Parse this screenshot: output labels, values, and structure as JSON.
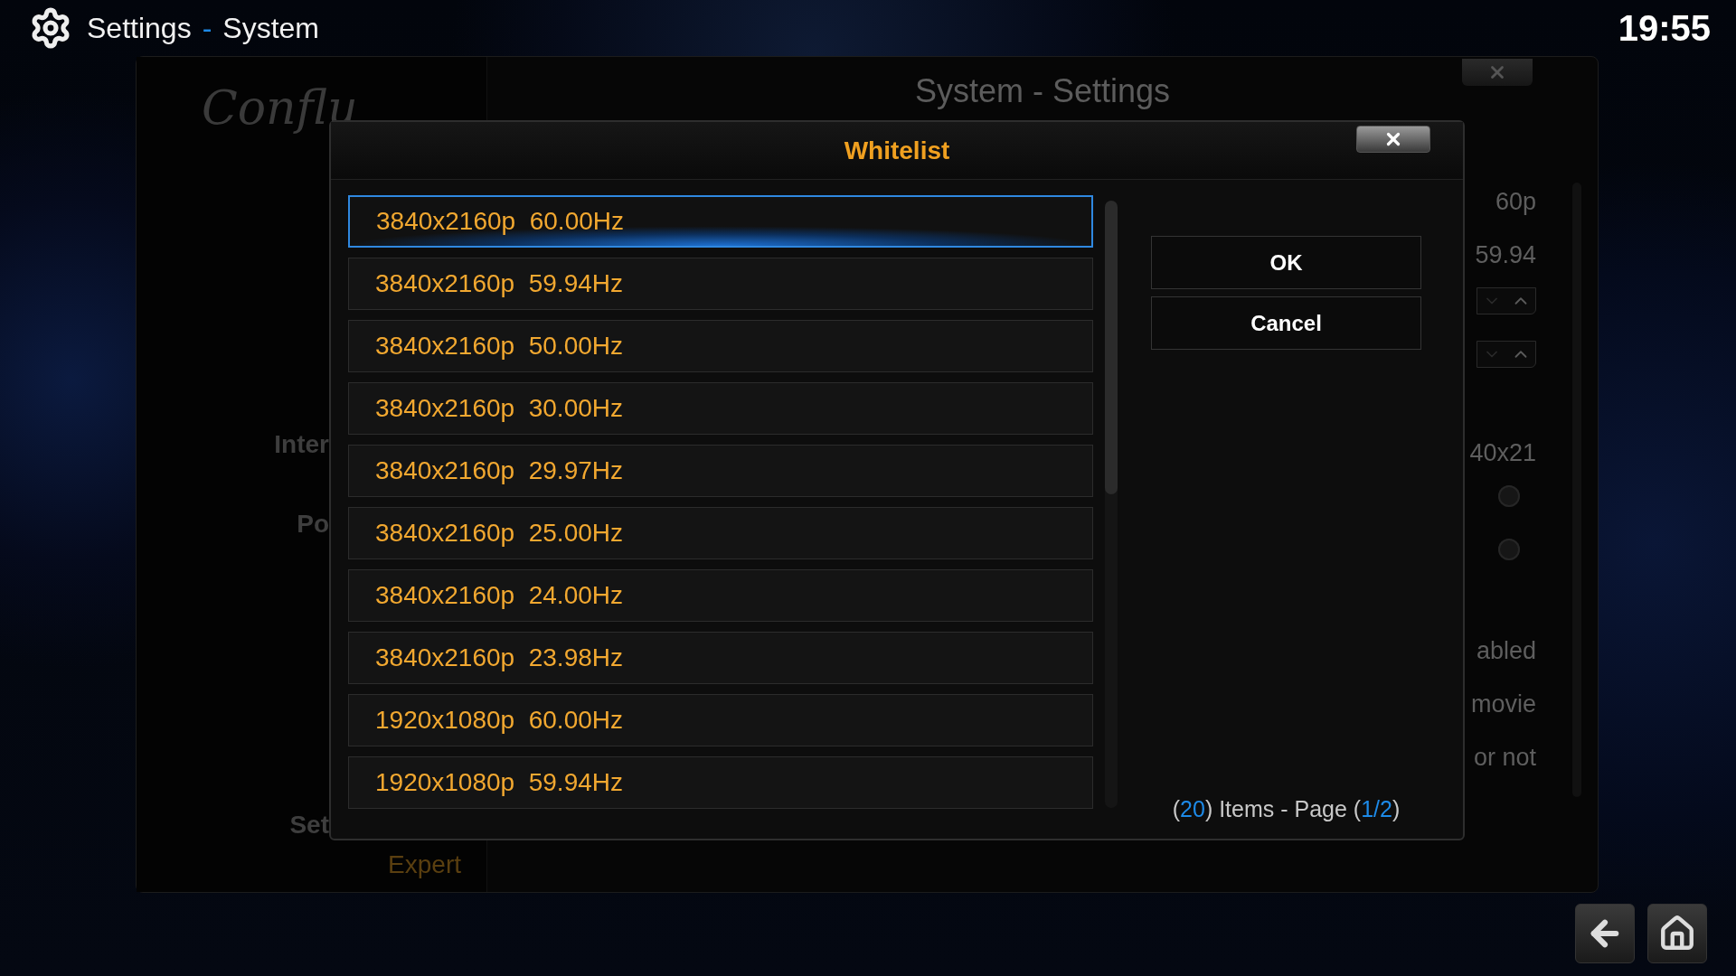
{
  "header": {
    "title_parts": [
      {
        "text": "Settings",
        "accent": false
      },
      {
        "text": "-",
        "accent": true
      },
      {
        "text": "System",
        "accent": false
      }
    ],
    "clock": "19:55"
  },
  "background_window": {
    "title": "System - Settings",
    "logo": "Conflu",
    "sidebar_items": [
      {
        "label": "Inter"
      },
      {
        "label": "Po"
      }
    ],
    "settings_level_label": "Set",
    "settings_level_value": "Expert",
    "right_values": [
      {
        "kind": "text",
        "text": "60p"
      },
      {
        "kind": "text",
        "text": "59.94"
      },
      {
        "kind": "spinner"
      },
      {
        "kind": "spinner"
      },
      {
        "kind": "text",
        "text": "40x21"
      },
      {
        "kind": "radio",
        "on": false
      },
      {
        "kind": "radio",
        "on": false
      },
      {
        "kind": "text",
        "text": "abled"
      },
      {
        "kind": "text",
        "text": "movie"
      },
      {
        "kind": "text",
        "text": "or not"
      }
    ]
  },
  "dialog": {
    "title": "Whitelist",
    "items": [
      {
        "label": "3840x2160p  60.00Hz",
        "selected": true
      },
      {
        "label": "3840x2160p  59.94Hz",
        "selected": false
      },
      {
        "label": "3840x2160p  50.00Hz",
        "selected": false
      },
      {
        "label": "3840x2160p  30.00Hz",
        "selected": false
      },
      {
        "label": "3840x2160p  29.97Hz",
        "selected": false
      },
      {
        "label": "3840x2160p  25.00Hz",
        "selected": false
      },
      {
        "label": "3840x2160p  24.00Hz",
        "selected": false
      },
      {
        "label": "3840x2160p  23.98Hz",
        "selected": false
      },
      {
        "label": "1920x1080p  60.00Hz",
        "selected": false
      },
      {
        "label": "1920x1080p  59.94Hz",
        "selected": false
      }
    ],
    "buttons": [
      "OK",
      "Cancel"
    ],
    "footer_parts": [
      {
        "text": "(",
        "accent": false
      },
      {
        "text": "20",
        "accent": true
      },
      {
        "text": ") Items - Page (",
        "accent": false
      },
      {
        "text": "1/2",
        "accent": true
      },
      {
        "text": ")",
        "accent": false
      }
    ]
  }
}
